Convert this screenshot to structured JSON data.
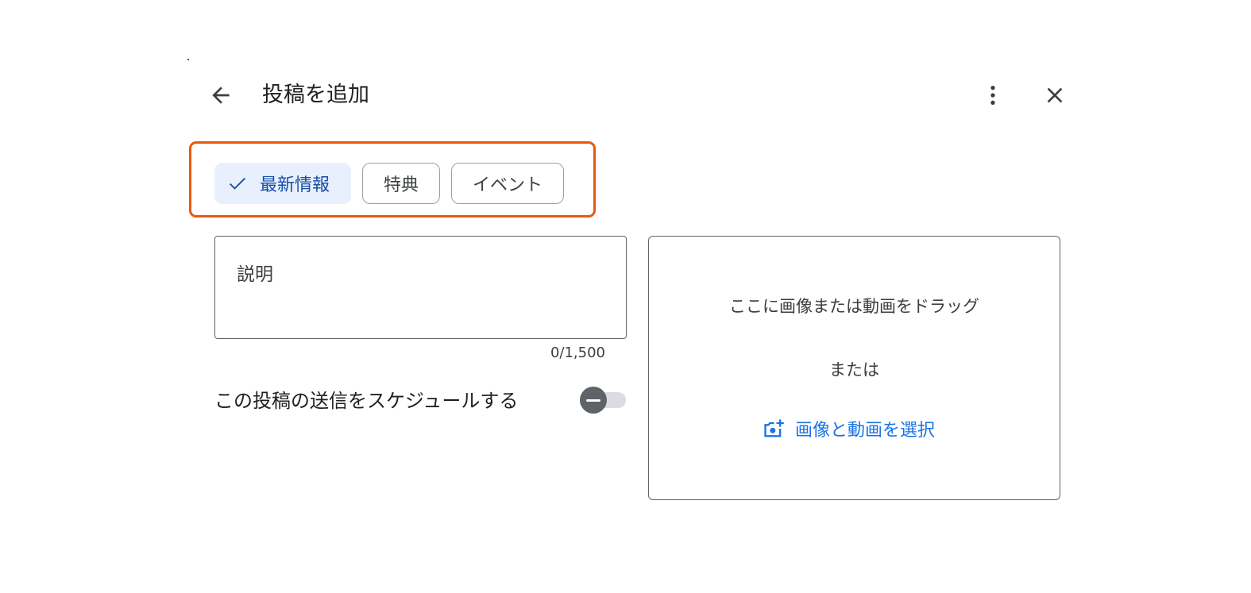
{
  "header": {
    "title": "投稿を追加"
  },
  "post_types": [
    {
      "label": "最新情報",
      "selected": true
    },
    {
      "label": "特典",
      "selected": false
    },
    {
      "label": "イベント",
      "selected": false
    }
  ],
  "description": {
    "label": "説明",
    "counter": "0/1,500"
  },
  "schedule": {
    "label": "この投稿の送信をスケジュールする",
    "enabled": false
  },
  "media": {
    "drag_text": "ここに画像または動画をドラッグ",
    "or_text": "または",
    "select_label": "画像と動画を選択"
  },
  "colors": {
    "accent_blue": "#1a73e8",
    "selected_chip_bg": "#e8f0fe",
    "highlight_orange": "#e8590c"
  },
  "icons": {
    "back": "arrow-back-icon",
    "more": "more-vert-icon",
    "close": "close-icon",
    "check": "check-icon",
    "add_photo": "add-photo-icon"
  }
}
